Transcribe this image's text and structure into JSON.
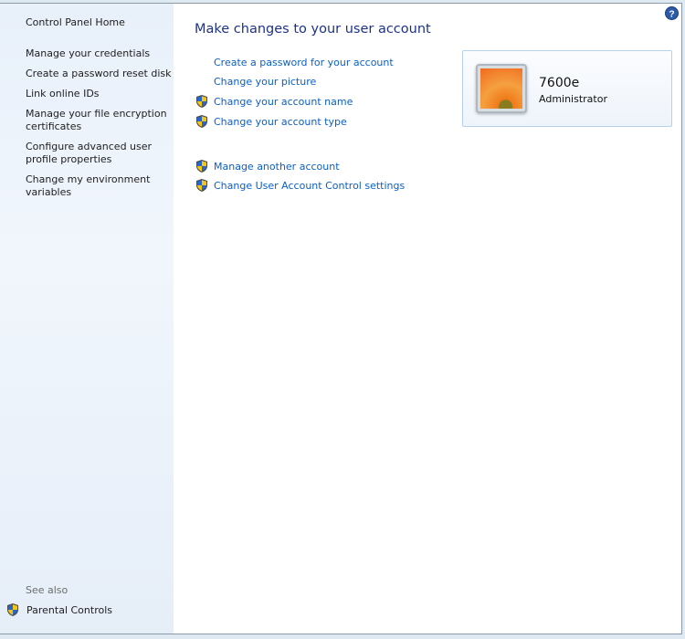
{
  "sidebar": {
    "home": "Control Panel Home",
    "links": [
      "Manage your credentials",
      "Create a password reset disk",
      "Link online IDs",
      "Manage your file encryption certificates",
      "Configure advanced user profile properties",
      "Change my environment variables"
    ],
    "see_also_label": "See also",
    "see_also": [
      {
        "label": "Parental Controls",
        "icon": "uac-shield-icon"
      }
    ]
  },
  "main": {
    "title": "Make changes to your user account",
    "tasks": [
      {
        "label": "Create a password for your account",
        "shield": false
      },
      {
        "label": "Change your picture",
        "shield": false
      },
      {
        "label": "Change your account name",
        "shield": true
      },
      {
        "label": "Change your account type",
        "shield": true
      },
      {
        "label": "Manage another account",
        "shield": true
      },
      {
        "label": "Change User Account Control settings",
        "shield": true
      }
    ]
  },
  "account": {
    "name": "7600e",
    "role": "Administrator",
    "picture": "orange-flower-picture"
  },
  "help": {
    "icon": "help-icon"
  },
  "colors": {
    "link": "#0b5fc6",
    "title": "#1e3287",
    "shield_blue": "#2a66c8",
    "shield_yellow": "#f3c613"
  }
}
